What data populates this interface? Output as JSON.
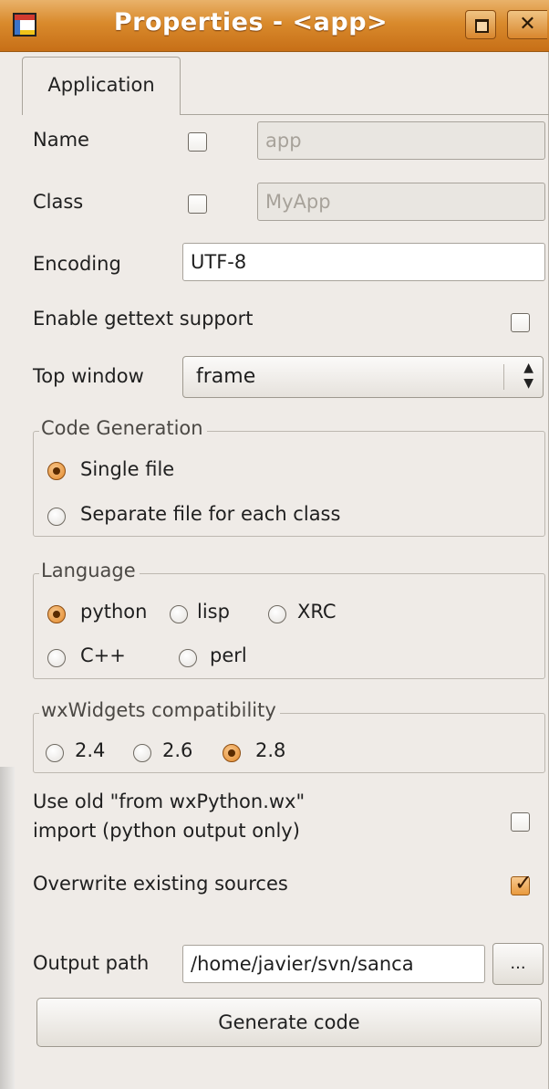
{
  "window": {
    "title": "Properties - <app>",
    "close_glyph": "✕"
  },
  "tabs": [
    {
      "label": "Application",
      "selected": true
    }
  ],
  "form": {
    "name": {
      "label": "Name",
      "checked": false,
      "value": "app",
      "enabled": false
    },
    "class": {
      "label": "Class",
      "checked": false,
      "value": "MyApp",
      "enabled": false
    },
    "encoding": {
      "label": "Encoding",
      "value": "UTF-8"
    },
    "gettext": {
      "label": "Enable gettext support",
      "checked": false
    },
    "top_window": {
      "label": "Top window",
      "value": "frame"
    },
    "code_generation": {
      "title": "Code Generation",
      "options": [
        {
          "label": "Single file",
          "selected": true
        },
        {
          "label": "Separate file for each class",
          "selected": false
        }
      ]
    },
    "language": {
      "title": "Language",
      "options": [
        {
          "label": "python",
          "selected": true
        },
        {
          "label": "lisp",
          "selected": false
        },
        {
          "label": "XRC",
          "selected": false
        },
        {
          "label": "C++",
          "selected": false
        },
        {
          "label": "perl",
          "selected": false
        }
      ]
    },
    "compat": {
      "title": "wxWidgets compatibility",
      "options": [
        {
          "label": "2.4",
          "selected": false
        },
        {
          "label": "2.6",
          "selected": false
        },
        {
          "label": "2.8",
          "selected": true
        }
      ]
    },
    "old_import": {
      "label_line1": "Use old \"from wxPython.wx\"",
      "label_line2": "import (python output only)",
      "checked": false
    },
    "overwrite": {
      "label": "Overwrite existing sources",
      "checked": true
    },
    "output_path": {
      "label": "Output path",
      "value": "/home/javier/svn/sanca",
      "browse_label": "..."
    },
    "generate_label": "Generate code"
  },
  "colors": {
    "titlebar_accent": "#d98a2c",
    "window_bg": "#efebe7",
    "radio_selected": "#e38a2c"
  }
}
